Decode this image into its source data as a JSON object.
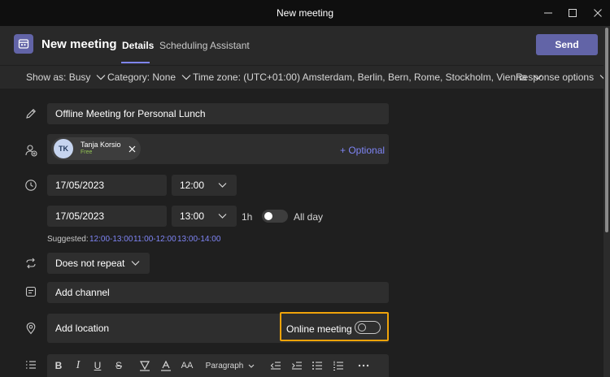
{
  "window": {
    "title": "New meeting",
    "controls": [
      "minimize-icon",
      "maximize-icon",
      "close-icon"
    ]
  },
  "header": {
    "title": "New meeting",
    "tabs": [
      {
        "label": "Details",
        "active": true
      },
      {
        "label": "Scheduling Assistant",
        "active": false
      }
    ],
    "send_label": "Send"
  },
  "options_bar": {
    "show_as": "Show as: Busy",
    "category": "Category: None",
    "time_zone": "Time zone: (UTC+01:00) Amsterdam, Berlin, Bern, Rome, Stockholm, Vienna",
    "response_options": "Response options"
  },
  "form": {
    "title_value": "Offline Meeting for Personal Lunch",
    "attendee": {
      "initials": "TK",
      "name": "Tanja Korsio",
      "status": "Free"
    },
    "optional_label": "+ Optional",
    "start_date": "17/05/2023",
    "start_time": "12:00",
    "end_date": "17/05/2023",
    "end_time": "13:00",
    "duration": "1h",
    "all_day_label": "All day",
    "all_day_on": false,
    "suggested_label": "Suggested:",
    "suggestions": [
      "12:00-13:00",
      "11:00-12:00",
      "13:00-14:00"
    ],
    "repeat": "Does not repeat",
    "channel_placeholder": "Add channel",
    "location_placeholder": "Add location",
    "online_meeting_label": "Online meeting",
    "online_meeting_on": false
  },
  "format_bar": {
    "paragraph_label": "Paragraph",
    "aa_label": "AA"
  },
  "colors": {
    "accent": "#6264a7",
    "accent_text": "#7f85f5",
    "highlight_border": "#f0a30a",
    "free_status": "#92c353"
  }
}
